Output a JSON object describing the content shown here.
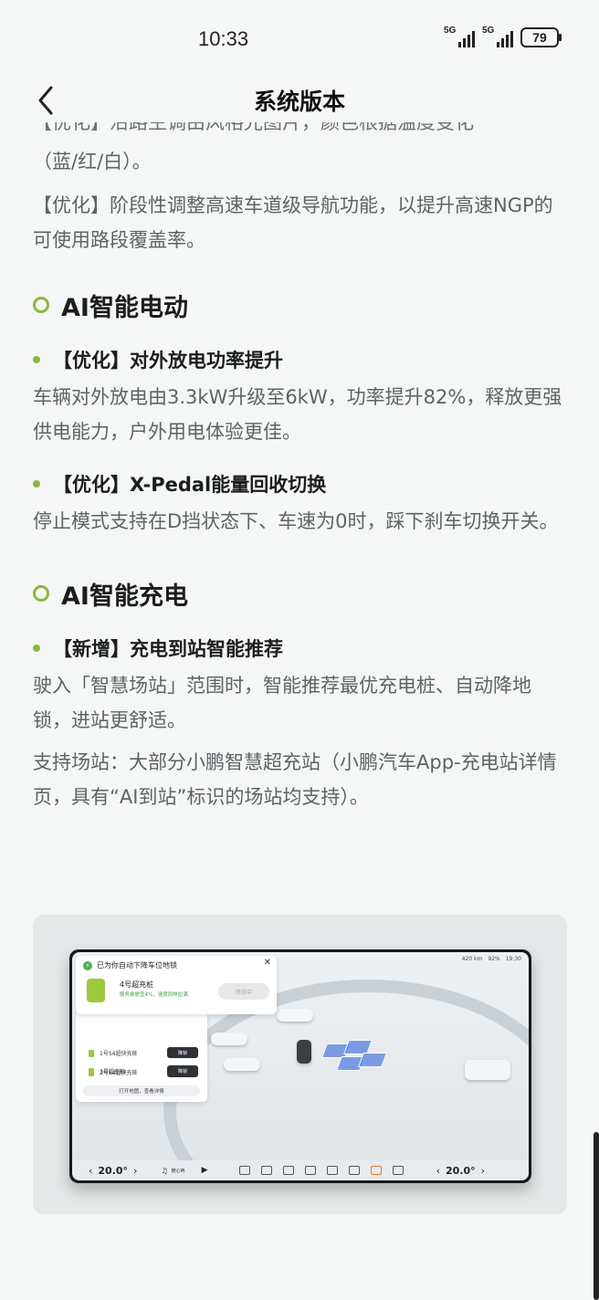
{
  "status_bar": {
    "time": "10:33",
    "signal1_label": "5G",
    "signal2_label": "5G",
    "battery": "79"
  },
  "nav": {
    "title": "系统版本"
  },
  "content": {
    "cut_line": "【优化】沿路主调由风格光图片，颜色根据温度变化",
    "para1": "（蓝/红/白）。",
    "para2": "【优化】阶段性调整高速车道级导航功能，以提升高速NGP的可使用路段覆盖率。",
    "sections": [
      {
        "title": "AI智能电动",
        "items": [
          {
            "title": "【优化】对外放电功率提升",
            "body": [
              "车辆对外放电由3.3kW升级至6kW，功率提升82%，释放更强供电能力，户外用电体验更佳。"
            ]
          },
          {
            "title": "【优化】X-Pedal能量回收切换",
            "body": [
              "停止模式支持在D挡状态下、车速为0时，踩下刹车切换开关。"
            ]
          }
        ]
      },
      {
        "title": "AI智能充电",
        "items": [
          {
            "title": "【新增】充电到站智能推荐",
            "body": [
              "驶入「智慧场站」范围时，智能推荐最优充电桩、自动降地锁，进站更舒适。",
              "支持场站：大部分小鹏智慧超充站（小鹏汽车App-充电站详情页，具有“AI到站”标识的场站均支持）。"
            ]
          }
        ]
      }
    ]
  },
  "screen": {
    "status": [
      "420 km",
      "92%",
      "19:30"
    ],
    "popup_title": "已为你自动下降车位地锁",
    "pile_name": "4号超充桩",
    "pile_note": "服务费便宜4%，速度同样拉满",
    "pile_button": "降锁中",
    "list": [
      {
        "name": "1号S4超快充桩",
        "btn": "降锁"
      },
      {
        "name": "2号S4超快充桩",
        "btn": "降锁"
      },
      {
        "name": "3号超充桩",
        "btn": "降锁"
      }
    ],
    "map_button": "打开地图，查看详情",
    "temp_left": "20.0°",
    "temp_right": "20.0°",
    "music": "随心听"
  }
}
